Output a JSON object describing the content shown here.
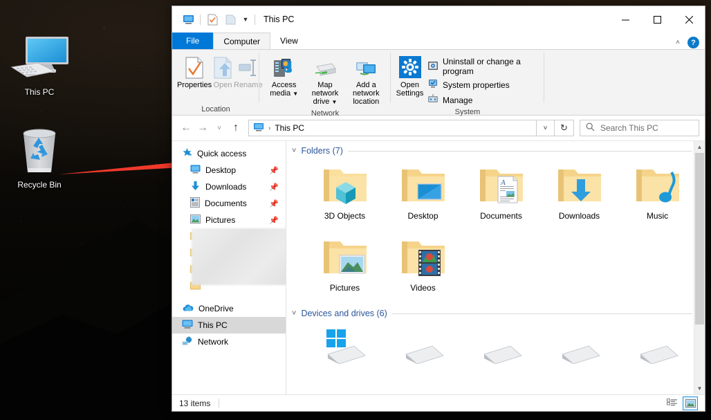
{
  "desktop": {
    "icons": [
      {
        "name": "This PC",
        "icon": "monitor-icon"
      },
      {
        "name": "Recycle Bin",
        "icon": "recycle-bin-icon"
      }
    ]
  },
  "annotation": {
    "type": "arrow",
    "color": "#f0392b",
    "points_to": "Quick access"
  },
  "window": {
    "title": "This PC",
    "quick_access_toolbar": [
      {
        "name": "this-pc-icon",
        "label": "This PC"
      },
      {
        "name": "properties-icon",
        "label": "Properties"
      },
      {
        "name": "new-folder-icon",
        "label": "New folder"
      },
      {
        "name": "customize-caret",
        "label": "Customize Quick Access Toolbar"
      }
    ],
    "controls": {
      "minimize": "—",
      "maximize": "☐",
      "close": "✕"
    }
  },
  "ribbon": {
    "tabs": [
      {
        "label": "File",
        "kind": "file"
      },
      {
        "label": "Computer",
        "kind": "active"
      },
      {
        "label": "View",
        "kind": "normal"
      }
    ],
    "collapse_label": "˄",
    "help_label": "?",
    "groups": [
      {
        "name": "Location",
        "buttons": [
          {
            "label": "Properties",
            "icon": "properties-icon",
            "enabled": true,
            "dropdown": false
          },
          {
            "label": "Open",
            "icon": "open-icon",
            "enabled": false,
            "dropdown": false
          },
          {
            "label": "Rename",
            "icon": "rename-icon",
            "enabled": false,
            "dropdown": false
          }
        ]
      },
      {
        "name": "Network",
        "buttons": [
          {
            "label": "Access media",
            "icon": "access-media-icon",
            "enabled": true,
            "dropdown": true
          },
          {
            "label": "Map network drive",
            "icon": "map-network-drive-icon",
            "enabled": true,
            "dropdown": true
          },
          {
            "label": "Add a network location",
            "icon": "add-network-location-icon",
            "enabled": true,
            "dropdown": false
          }
        ]
      },
      {
        "name": "System",
        "big_button": {
          "label": "Open Settings",
          "icon": "gear-icon"
        },
        "items": [
          {
            "label": "Uninstall or change a program",
            "icon": "uninstall-icon"
          },
          {
            "label": "System properties",
            "icon": "system-properties-icon"
          },
          {
            "label": "Manage",
            "icon": "manage-icon"
          }
        ]
      }
    ]
  },
  "navbar": {
    "back": "←",
    "forward": "→",
    "recent": "˅",
    "up": "↑",
    "breadcrumb": [
      "This PC"
    ],
    "breadcrumb_icon": "this-pc-icon",
    "breadcrumb_sep": "›",
    "address_dropdown": "˅",
    "refresh": "↻",
    "search_placeholder": "Search This PC",
    "search_value": "",
    "search_icon": "search-icon"
  },
  "sidebar": {
    "items": [
      {
        "label": "Quick access",
        "icon": "star-pin-icon",
        "level": 1,
        "pinned": false,
        "selected": false
      },
      {
        "label": "Desktop",
        "icon": "desktop-icon",
        "level": 2,
        "pinned": true,
        "selected": false
      },
      {
        "label": "Downloads",
        "icon": "downloads-icon",
        "level": 2,
        "pinned": true,
        "selected": false
      },
      {
        "label": "Documents",
        "icon": "documents-icon",
        "level": 2,
        "pinned": true,
        "selected": false
      },
      {
        "label": "Pictures",
        "icon": "pictures-icon",
        "level": 2,
        "pinned": true,
        "selected": false
      },
      {
        "label": "",
        "icon": "folder-icon",
        "level": 2,
        "pinned": false,
        "selected": false,
        "blurred": true
      },
      {
        "label": "",
        "icon": "folder-icon",
        "level": 2,
        "pinned": false,
        "selected": false,
        "blurred": true
      },
      {
        "label": "",
        "icon": "folder-icon",
        "level": 2,
        "pinned": false,
        "selected": false,
        "blurred": true
      },
      {
        "label": "",
        "icon": "folder-icon",
        "level": 2,
        "pinned": false,
        "selected": false,
        "blurred": true
      },
      {
        "label": "OneDrive",
        "icon": "onedrive-icon",
        "level": 1,
        "pinned": false,
        "selected": false
      },
      {
        "label": "This PC",
        "icon": "this-pc-icon",
        "level": 1,
        "pinned": false,
        "selected": true
      },
      {
        "label": "Network",
        "icon": "network-icon",
        "level": 1,
        "pinned": false,
        "selected": false
      }
    ]
  },
  "content": {
    "groups": [
      {
        "header": "Folders (7)",
        "twisty": "˅",
        "items": [
          {
            "name": "3D Objects",
            "icon": "folder-3d-objects-icon"
          },
          {
            "name": "Desktop",
            "icon": "folder-desktop-icon"
          },
          {
            "name": "Documents",
            "icon": "folder-documents-icon"
          },
          {
            "name": "Downloads",
            "icon": "folder-downloads-icon"
          },
          {
            "name": "Music",
            "icon": "folder-music-icon"
          },
          {
            "name": "Pictures",
            "icon": "folder-pictures-icon"
          },
          {
            "name": "Videos",
            "icon": "folder-videos-icon"
          }
        ]
      },
      {
        "header": "Devices and drives (6)",
        "twisty": "˅",
        "items": [
          {
            "name": "",
            "icon": "windows-drive-icon"
          },
          {
            "name": "",
            "icon": "drive-icon"
          },
          {
            "name": "",
            "icon": "drive-icon"
          },
          {
            "name": "",
            "icon": "drive-icon"
          },
          {
            "name": "",
            "icon": "drive-icon"
          }
        ]
      }
    ]
  },
  "statusbar": {
    "item_count": "13 items",
    "views": [
      {
        "name": "details-view",
        "active": false
      },
      {
        "name": "large-icons-view",
        "active": true
      }
    ]
  },
  "colors": {
    "accent": "#0078d7",
    "selection": "#cce8ff",
    "group_header": "#2a5699",
    "annotation_red": "#f0392b",
    "folder_yellow": "#ffd77a"
  }
}
